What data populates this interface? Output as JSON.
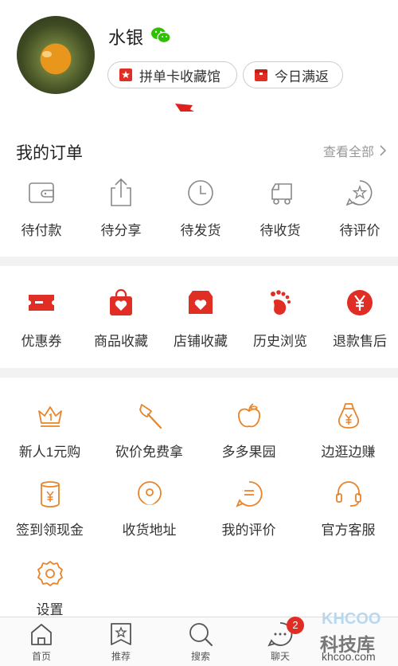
{
  "profile": {
    "username": "水银",
    "badges": [
      {
        "label": "拼单卡收藏馆",
        "icon": "card-icon"
      },
      {
        "label": "今日满返",
        "icon": "gift-icon"
      }
    ]
  },
  "orders": {
    "title": "我的订单",
    "view_all": "查看全部",
    "items": [
      {
        "label": "待付款",
        "icon": "wallet-icon"
      },
      {
        "label": "待分享",
        "icon": "share-icon"
      },
      {
        "label": "待发货",
        "icon": "clock-icon"
      },
      {
        "label": "待收货",
        "icon": "truck-icon"
      },
      {
        "label": "待评价",
        "icon": "review-star-icon"
      }
    ]
  },
  "collections": {
    "items": [
      {
        "label": "优惠券",
        "icon": "coupon-icon"
      },
      {
        "label": "商品收藏",
        "icon": "bag-heart-icon"
      },
      {
        "label": "店铺收藏",
        "icon": "store-heart-icon"
      },
      {
        "label": "历史浏览",
        "icon": "footprint-icon"
      },
      {
        "label": "退款售后",
        "icon": "yen-circle-icon"
      }
    ]
  },
  "tools": {
    "items": [
      {
        "label": "新人1元购",
        "icon": "crown-icon"
      },
      {
        "label": "砍价免费拿",
        "icon": "axe-icon"
      },
      {
        "label": "多多果园",
        "icon": "fruit-icon"
      },
      {
        "label": "边逛边赚",
        "icon": "money-bag-icon"
      },
      {
        "label": "签到领现金",
        "icon": "cash-cup-icon"
      },
      {
        "label": "收货地址",
        "icon": "location-pin-icon"
      },
      {
        "label": "我的评价",
        "icon": "comment-icon"
      },
      {
        "label": "官方客服",
        "icon": "headset-icon"
      },
      {
        "label": "设置",
        "icon": "gear-icon"
      }
    ]
  },
  "bottom_nav": {
    "items": [
      {
        "label": "首页",
        "icon": "home-icon"
      },
      {
        "label": "推荐",
        "icon": "recommend-icon"
      },
      {
        "label": "搜索",
        "icon": "search-icon"
      },
      {
        "label": "聊天",
        "icon": "chat-icon",
        "badge": "2"
      }
    ]
  },
  "watermark": {
    "logo": "KHCOO",
    "name": "科技库",
    "url": "khcoo.com"
  },
  "colors": {
    "accent": "#e02e24",
    "tool_orange": "#e8842a",
    "icon_gray": "#888888",
    "arrow_red": "#e0201c",
    "wechat_green": "#2dc100"
  }
}
